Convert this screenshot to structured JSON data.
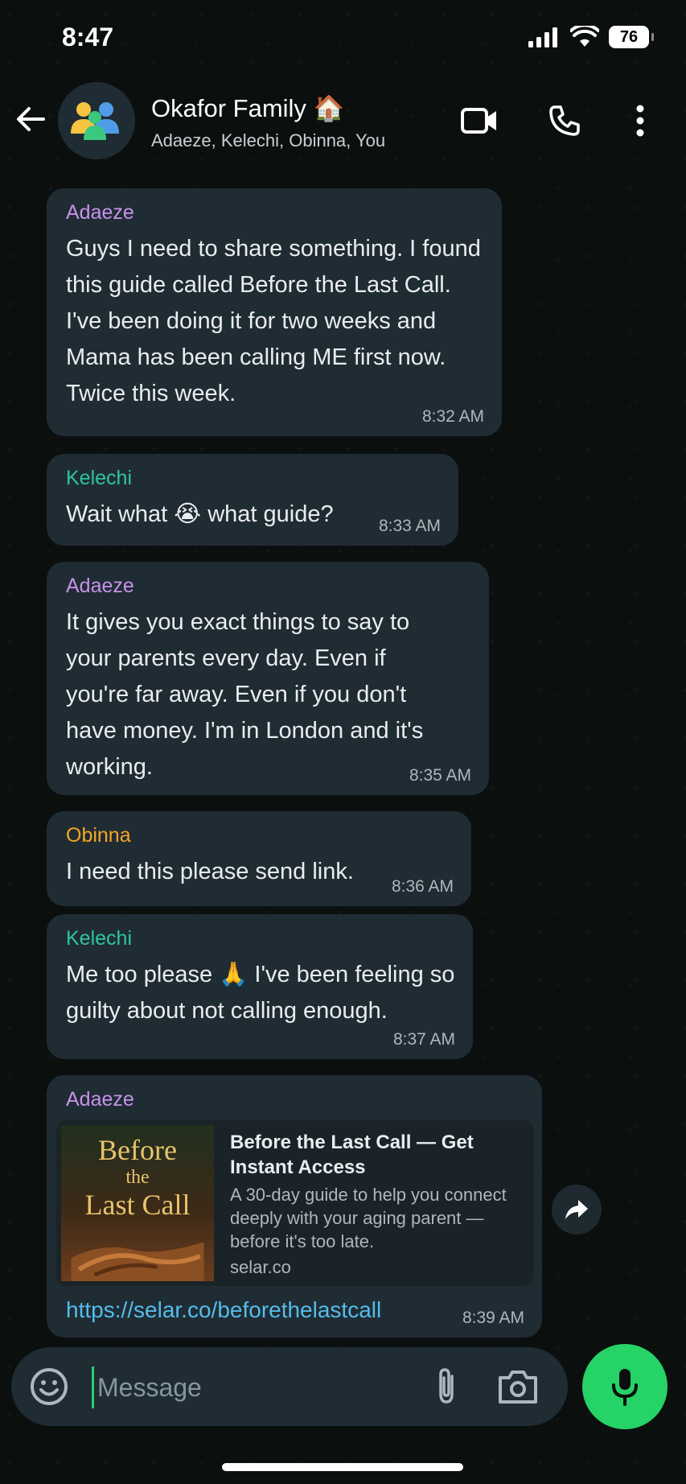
{
  "status_bar": {
    "time": "8:47",
    "battery": "76"
  },
  "header": {
    "title": "Okafor Family 🏠",
    "subtitle": "Adaeze, Kelechi, Obinna, You"
  },
  "colors": {
    "adaeze": "#c792ea",
    "kelechi": "#2ec4a5",
    "obinna": "#f5a623",
    "link": "#53bdeb",
    "mic": "#25d366"
  },
  "messages": [
    {
      "sender": "Adaeze",
      "text": "Guys I need to share something. I found this guide called Before the Last Call. I've been doing it for two weeks and Mama has been calling ME first now. Twice this week.",
      "time": "8:32 AM"
    },
    {
      "sender": "Kelechi",
      "text": "Wait what 😭 what guide?",
      "time": "8:33 AM"
    },
    {
      "sender": "Adaeze",
      "text": "It gives you exact things to say to your parents every day. Even if you're far away. Even if you don't have money. I'm in London and it's working.",
      "time": "8:35 AM"
    },
    {
      "sender": "Obinna",
      "text": "I need this please send link.",
      "time": "8:36 AM"
    },
    {
      "sender": "Kelechi",
      "text": "Me too please 🙏 I've been feeling so guilty about not calling enough.",
      "time": "8:37 AM"
    },
    {
      "sender": "Adaeze",
      "link_preview": {
        "thumb_line1": "Before",
        "thumb_line2": "the",
        "thumb_line3": "Last Call",
        "title": "Before the Last Call — Get Instant Access",
        "description": "A 30-day guide to help you connect deeply with your aging parent — before it's too late.",
        "domain": "selar.co"
      },
      "url": "https://selar.co/beforethelastcall",
      "time": "8:39 AM"
    }
  ],
  "input": {
    "placeholder": "Message"
  }
}
